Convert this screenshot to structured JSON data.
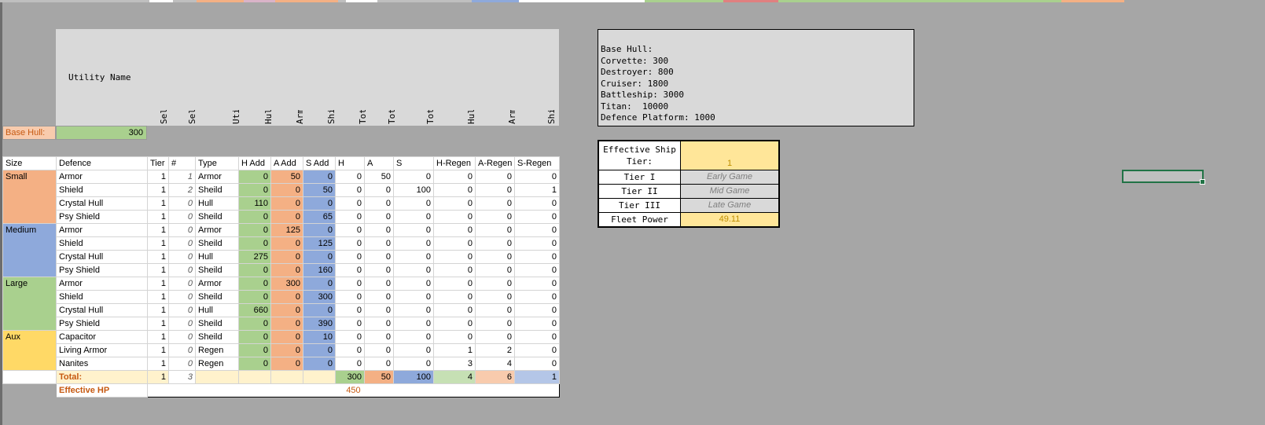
{
  "headers": {
    "utility_name": "Utility Name",
    "columns": [
      "Select Utility Ti",
      "Select Utility Co",
      "Utility type",
      "Hull Added",
      "Armor Added",
      "Shields Added",
      "Total Hull added",
      "Total Armor Added",
      "Total Shields Add",
      "Hull Regen",
      "Armor Regen",
      "Shield Regen"
    ]
  },
  "base_hull": {
    "label": "Base Hull:",
    "value": "300"
  },
  "table": {
    "columns": [
      "Size",
      "Defence",
      "Tier",
      "#",
      "Type",
      "H Add",
      "A Add",
      "S Add",
      "H",
      "A",
      "S",
      "H-Regen",
      "A-Regen",
      "S-Regen"
    ],
    "groups": [
      {
        "size": "Small",
        "color": "#f4b084",
        "rows": [
          [
            "Armor",
            "1",
            "1",
            "Armor",
            "0",
            "50",
            "0",
            "0",
            "50",
            "0",
            "0",
            "0",
            "0"
          ],
          [
            "Shield",
            "1",
            "2",
            "Sheild",
            "0",
            "0",
            "50",
            "0",
            "0",
            "100",
            "0",
            "0",
            "1"
          ],
          [
            "Crystal Hull",
            "1",
            "0",
            "Hull",
            "110",
            "0",
            "0",
            "0",
            "0",
            "0",
            "0",
            "0",
            "0"
          ],
          [
            "Psy Shield",
            "1",
            "0",
            "Sheild",
            "0",
            "0",
            "65",
            "0",
            "0",
            "0",
            "0",
            "0",
            "0"
          ]
        ]
      },
      {
        "size": "Medium",
        "color": "#8ea9db",
        "rows": [
          [
            "Armor",
            "1",
            "0",
            "Armor",
            "0",
            "125",
            "0",
            "0",
            "0",
            "0",
            "0",
            "0",
            "0"
          ],
          [
            "Shield",
            "1",
            "0",
            "Sheild",
            "0",
            "0",
            "125",
            "0",
            "0",
            "0",
            "0",
            "0",
            "0"
          ],
          [
            "Crystal Hull",
            "1",
            "0",
            "Hull",
            "275",
            "0",
            "0",
            "0",
            "0",
            "0",
            "0",
            "0",
            "0"
          ],
          [
            "Psy Shield",
            "1",
            "0",
            "Sheild",
            "0",
            "0",
            "160",
            "0",
            "0",
            "0",
            "0",
            "0",
            "0"
          ]
        ]
      },
      {
        "size": "Large",
        "color": "#a9d08e",
        "rows": [
          [
            "Armor",
            "1",
            "0",
            "Armor",
            "0",
            "300",
            "0",
            "0",
            "0",
            "0",
            "0",
            "0",
            "0"
          ],
          [
            "Shield",
            "1",
            "0",
            "Sheild",
            "0",
            "0",
            "300",
            "0",
            "0",
            "0",
            "0",
            "0",
            "0"
          ],
          [
            "Crystal Hull",
            "1",
            "0",
            "Hull",
            "660",
            "0",
            "0",
            "0",
            "0",
            "0",
            "0",
            "0",
            "0"
          ],
          [
            "Psy Shield",
            "1",
            "0",
            "Sheild",
            "0",
            "0",
            "390",
            "0",
            "0",
            "0",
            "0",
            "0",
            "0"
          ]
        ]
      },
      {
        "size": "Aux",
        "color": "#ffd966",
        "rows": [
          [
            "Capacitor",
            "1",
            "0",
            "Sheild",
            "0",
            "0",
            "10",
            "0",
            "0",
            "0",
            "0",
            "0",
            "0"
          ],
          [
            "Living Armor",
            "1",
            "0",
            "Regen",
            "0",
            "0",
            "0",
            "0",
            "0",
            "0",
            "1",
            "2",
            "0"
          ],
          [
            "Nanites",
            "1",
            "0",
            "Regen",
            "0",
            "0",
            "0",
            "0",
            "0",
            "0",
            "3",
            "4",
            "0"
          ]
        ]
      }
    ],
    "total": {
      "label": "Total:",
      "tier": "1",
      "count": "3",
      "h": "300",
      "a": "50",
      "s": "100",
      "hregen": "4",
      "aregen": "6",
      "sregen": "1"
    },
    "effective_hp": {
      "label": "Effective HP",
      "value": "450"
    }
  },
  "notes": [
    "Base Hull:",
    "Corvette: 300",
    "Destroyer: 800",
    "Cruiser: 1800",
    "Battleship: 3000",
    "Titan:  10000",
    "Defence Platform: 1000"
  ],
  "tier_box": {
    "eff_label_1": "Effective Ship",
    "eff_label_2": "Tier:",
    "eff_value": "1",
    "rows": [
      {
        "label": "Tier I",
        "value": "Early Game"
      },
      {
        "label": "Tier II",
        "value": "Mid Game"
      },
      {
        "label": "Tier III",
        "value": "Late Game"
      }
    ],
    "fleet_power_label": "Fleet Power",
    "fleet_power_value": "49.11"
  },
  "colors": {
    "hull": "#a9d08e",
    "armor": "#f4b084",
    "shield": "#8ea9db",
    "aux": "#ffd966",
    "accent": "#c65911"
  }
}
